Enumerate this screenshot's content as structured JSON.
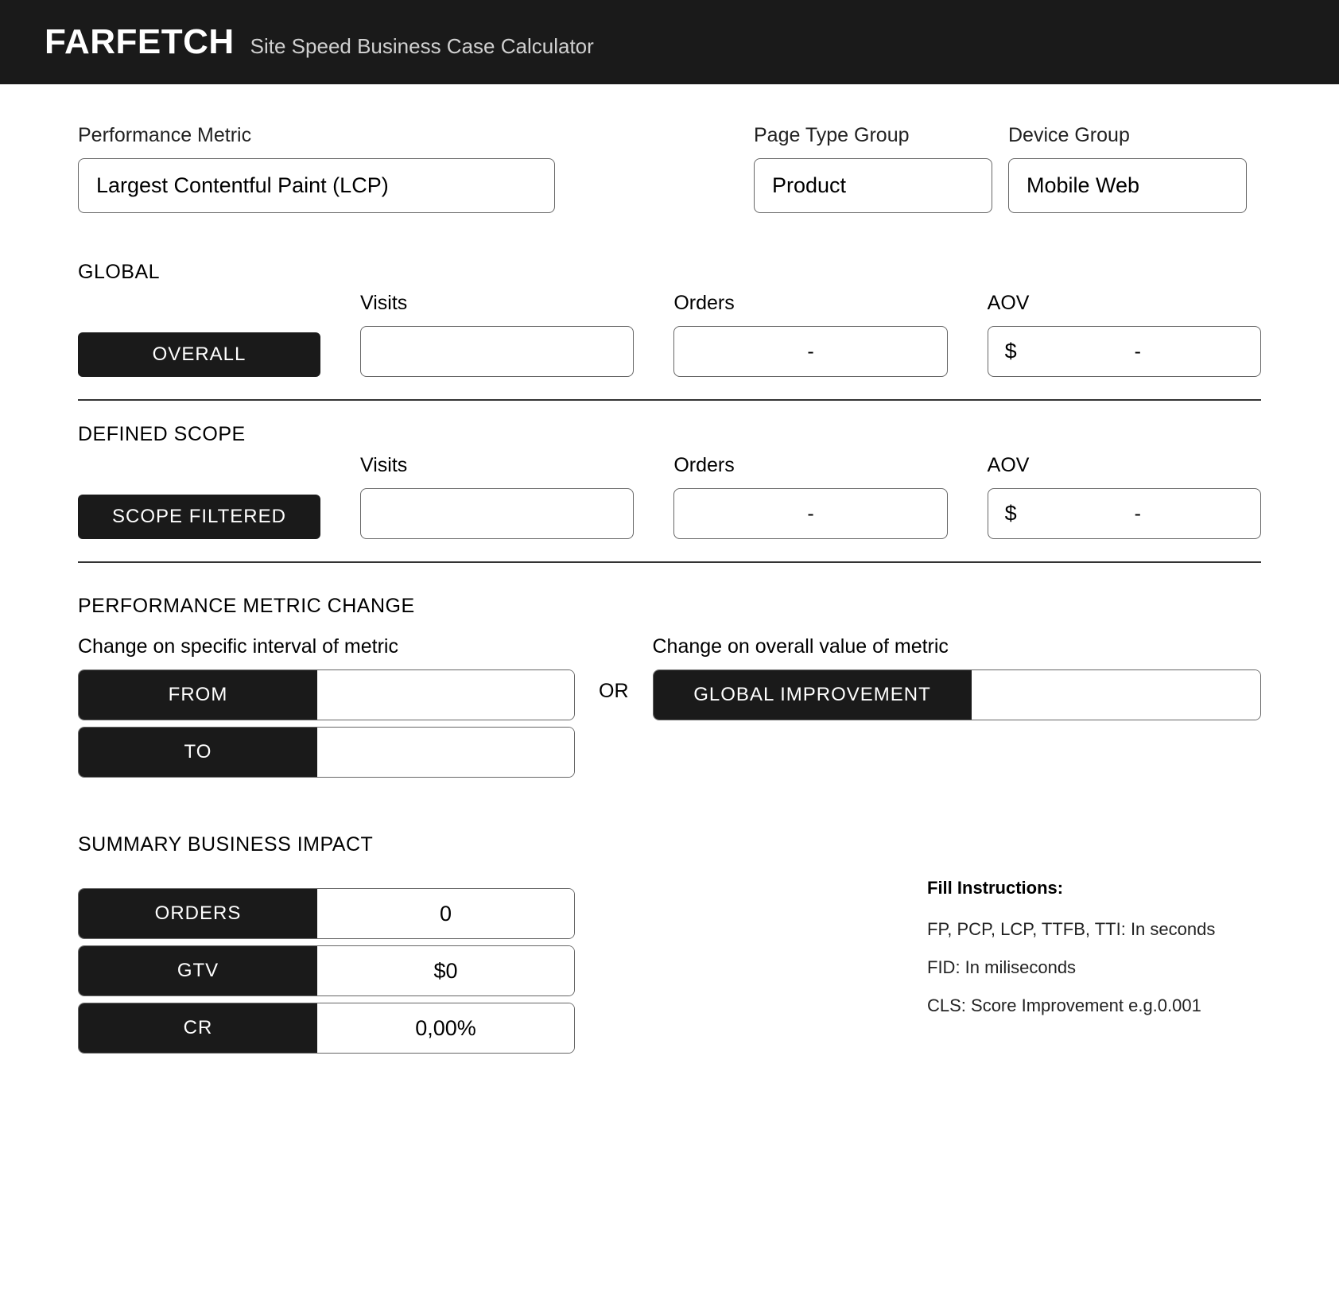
{
  "header": {
    "logo": "FARFETCH",
    "subtitle": "Site Speed Business Case Calculator"
  },
  "filters": {
    "metric": {
      "label": "Performance Metric",
      "value": "Largest Contentful Paint (LCP)"
    },
    "page": {
      "label": "Page Type Group",
      "value": "Product"
    },
    "device": {
      "label": "Device Group",
      "value": "Mobile Web"
    }
  },
  "global": {
    "heading": "GLOBAL",
    "badge": "OVERALL",
    "visits": {
      "label": "Visits",
      "value": ""
    },
    "orders": {
      "label": "Orders",
      "value": "-"
    },
    "aov": {
      "label": "AOV",
      "currency": "$",
      "value": "-"
    }
  },
  "scope": {
    "heading": "DEFINED SCOPE",
    "badge": "SCOPE FILTERED",
    "visits": {
      "label": "Visits",
      "value": ""
    },
    "orders": {
      "label": "Orders",
      "value": "-"
    },
    "aov": {
      "label": "AOV",
      "currency": "$",
      "value": "-"
    }
  },
  "change": {
    "heading": "PERFORMANCE METRIC CHANGE",
    "interval_label": "Change on specific interval of metric",
    "from_label": "FROM",
    "to_label": "TO",
    "from_value": "",
    "to_value": "",
    "or": "OR",
    "overall_label": "Change on overall value of metric",
    "global_label": "GLOBAL IMPROVEMENT",
    "global_value": ""
  },
  "summary": {
    "heading": "SUMMARY BUSINESS IMPACT",
    "orders": {
      "label": "ORDERS",
      "value": "0"
    },
    "gtv": {
      "label": "GTV",
      "value": "$0"
    },
    "cr": {
      "label": "CR",
      "value": "0,00%"
    }
  },
  "instructions": {
    "title": "Fill Instructions:",
    "line1": "FP, PCP, LCP, TTFB, TTI: In seconds",
    "line2": "FID: In miliseconds",
    "line3": "CLS: Score Improvement e.g.0.001"
  }
}
